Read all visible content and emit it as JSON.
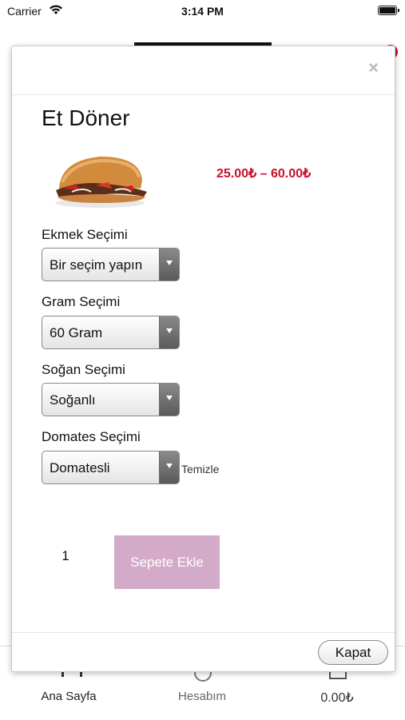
{
  "status_bar": {
    "carrier": "Carrier",
    "time": "3:14 PM"
  },
  "bottom_nav": {
    "items": [
      {
        "label": "Ana Sayfa",
        "icon": "home-icon"
      },
      {
        "label": "Hesabım",
        "icon": "account-icon"
      },
      {
        "label": "0.00₺",
        "icon": "cart-icon"
      }
    ]
  },
  "modal": {
    "close_symbol": "×",
    "title": "Et Döner",
    "image_alt": "Et Döner",
    "price_range": "25.00₺ – 60.00₺",
    "options": [
      {
        "label": "Ekmek Seçimi",
        "value": "Bir seçim yapın"
      },
      {
        "label": "Gram Seçimi",
        "value": "60 Gram"
      },
      {
        "label": "Soğan Seçimi",
        "value": "Soğanlı"
      },
      {
        "label": "Domates Seçimi",
        "value": "Domatesli"
      }
    ],
    "clear_label": "Temizle",
    "quantity": "1",
    "add_to_cart_label": "Sepete Ekle",
    "footer_close_label": "Kapat"
  },
  "colors": {
    "price": "#c8102e",
    "add_to_cart_bg": "#d3aac8"
  }
}
